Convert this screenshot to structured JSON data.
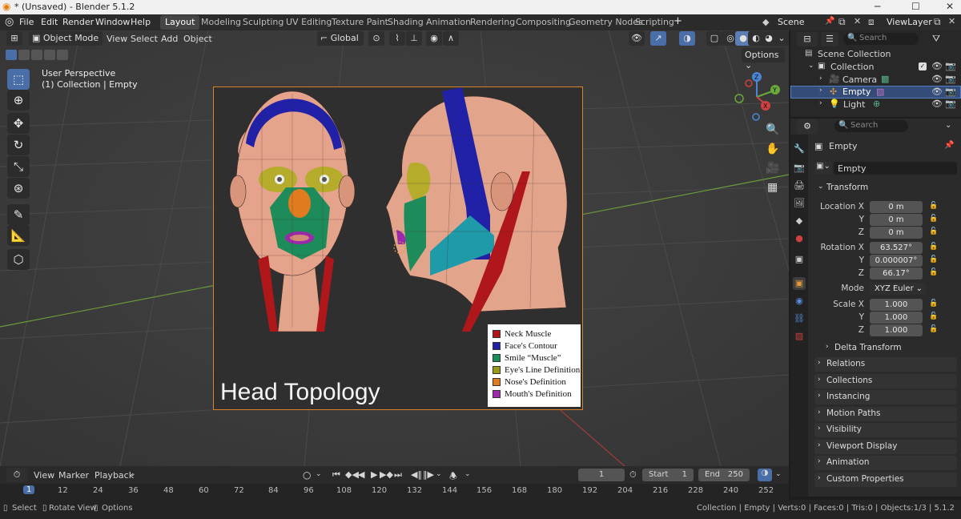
{
  "window": {
    "title": "* (Unsaved) - Blender 5.1.2",
    "minimize": "─",
    "maximize": "☐",
    "close": "✕"
  },
  "menubar": {
    "items": [
      "File",
      "Edit",
      "Render",
      "Window",
      "Help"
    ],
    "workspaces": [
      "Layout",
      "Modeling",
      "Sculpting",
      "UV Editing",
      "Texture Paint",
      "Shading",
      "Animation",
      "Rendering",
      "Compositing",
      "Geometry Nodes",
      "Scripting"
    ],
    "active_workspace": "Layout",
    "add_workspace": "+",
    "scene_label": "Scene",
    "view_layer_label": "ViewLayer"
  },
  "viewport": {
    "mode": "Object Mode",
    "menus": [
      "View",
      "Select",
      "Add",
      "Object"
    ],
    "orientation": "Global",
    "options_label": "Options",
    "perspective_text": "User Perspective",
    "collection_text": "(1) Collection | Empty",
    "gizmo": {
      "x": "X",
      "y": "Y",
      "z": "Z"
    }
  },
  "figure": {
    "title": "Head Topology",
    "legend": [
      {
        "label": "Neck Muscle",
        "color": "#b0171b"
      },
      {
        "label": "Face's Contour",
        "color": "#2121a8"
      },
      {
        "label": "Smile “Muscle”",
        "color": "#1e8c5a"
      },
      {
        "label": "Eye's Line Definition",
        "color": "#9a9a1a"
      },
      {
        "label": "Nose's Definition",
        "color": "#e07b1f"
      },
      {
        "label": "Mouth's Definition",
        "color": "#9a2aa8"
      }
    ]
  },
  "outliner": {
    "search_placeholder": "Search",
    "rows": [
      {
        "label": "Scene Collection"
      },
      {
        "label": "Collection"
      },
      {
        "label": "Camera"
      },
      {
        "label": "Empty"
      },
      {
        "label": "Light"
      }
    ]
  },
  "properties": {
    "search_placeholder": "Search",
    "object_name": "Empty",
    "datablock_name": "Empty",
    "transform_label": "Transform",
    "location": {
      "label_x": "Location X",
      "label_y": "Y",
      "label_z": "Z",
      "x": "0 m",
      "y": "0 m",
      "z": "0 m"
    },
    "rotation": {
      "label_x": "Rotation X",
      "label_y": "Y",
      "label_z": "Z",
      "x": "63.527°",
      "y": "0.000007°",
      "z": "66.17°"
    },
    "mode": {
      "label": "Mode",
      "value": "XYZ Euler"
    },
    "scale": {
      "label_x": "Scale X",
      "label_y": "Y",
      "label_z": "Z",
      "x": "1.000",
      "y": "1.000",
      "z": "1.000"
    },
    "delta_transform": "Delta Transform",
    "sections": [
      "Relations",
      "Collections",
      "Instancing",
      "Motion Paths",
      "Visibility",
      "Viewport Display",
      "Animation",
      "Custom Properties"
    ]
  },
  "timeline": {
    "menus": [
      "View",
      "Marker",
      "Playback"
    ],
    "current_frame": "1",
    "start_label": "Start",
    "start": "1",
    "end_label": "End",
    "end": "250",
    "ruler": [
      "1",
      "12",
      "24",
      "36",
      "48",
      "60",
      "72",
      "84",
      "96",
      "108",
      "120",
      "132",
      "144",
      "156",
      "168",
      "180",
      "192",
      "204",
      "216",
      "228",
      "240",
      "252"
    ]
  },
  "statusbar": {
    "select": "Select",
    "rotate": "Rotate View",
    "options": "Options",
    "stats": "Collection | Empty | Verts:0 | Faces:0 | Tris:0 | Objects:1/3 | 5.1.2"
  }
}
